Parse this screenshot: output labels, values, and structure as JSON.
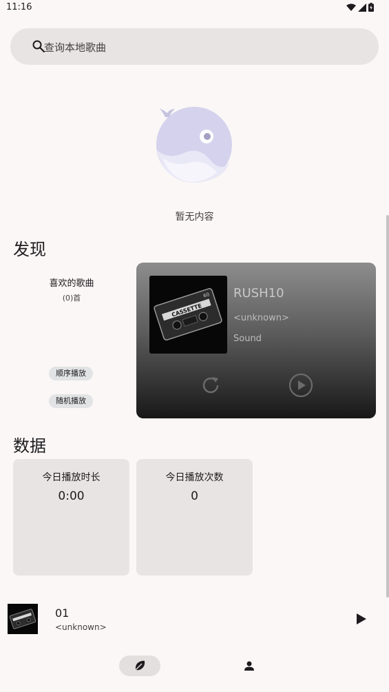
{
  "status_bar": {
    "time": "11:16"
  },
  "search": {
    "placeholder": "查询本地歌曲"
  },
  "empty_state": {
    "text": "暂无内容"
  },
  "discover": {
    "title": "发现",
    "favorites": {
      "title": "喜欢的歌曲",
      "count": "(0)首",
      "sequential_label": "顺序播放",
      "shuffle_label": "随机播放"
    },
    "player_card": {
      "title": "RUSH10",
      "artist": "<unknown>",
      "album": "Sound",
      "album_art_text": "CASSETTE",
      "album_art_number": "60"
    }
  },
  "stats": {
    "title": "数据",
    "play_time": {
      "label": "今日播放时长",
      "value": "0:00"
    },
    "play_count": {
      "label": "今日播放次数",
      "value": "0"
    }
  },
  "mini_player": {
    "title": "01",
    "artist": "<unknown>"
  },
  "colors": {
    "background": "#faf7f6",
    "surface": "#e8e4e3",
    "illustration": "#d4d2ec"
  },
  "icons": {
    "search": "search-icon",
    "repeat": "repeat-icon",
    "play": "play-circle-icon",
    "home": "leaf-icon",
    "profile": "person-icon"
  }
}
